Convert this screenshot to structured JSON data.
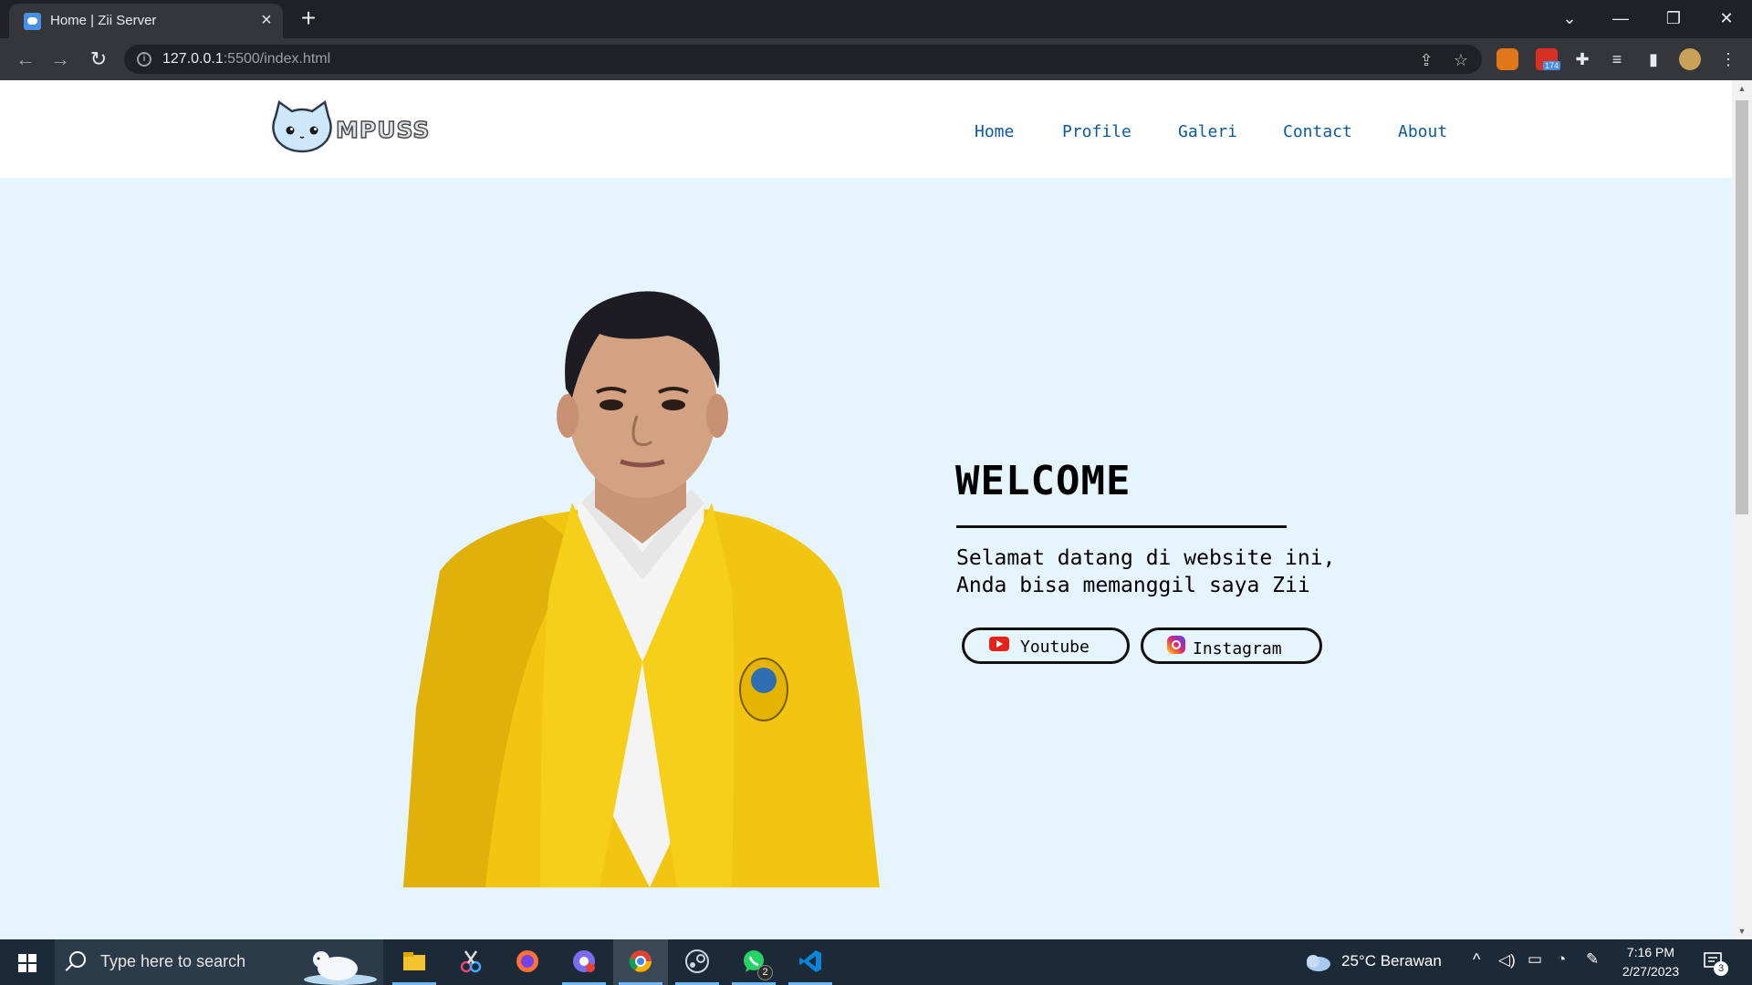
{
  "browser": {
    "tab_title": "Home | Zii Server",
    "url_host": "127.0.0.1",
    "url_rest": ":5500/index.html",
    "extension_badge": "174"
  },
  "site": {
    "logo_text": "MPUSS",
    "nav": [
      "Home",
      "Profile",
      "Galeri",
      "Contact",
      "About"
    ],
    "hero": {
      "heading": "WELCOME",
      "text": "Selamat datang di website ini,\nAnda bisa memanggil saya Zii",
      "buttons": {
        "youtube": "Youtube",
        "instagram": "Instagram"
      }
    }
  },
  "taskbar": {
    "search_placeholder": "Type here to search",
    "whatsapp_badge": "2",
    "weather": "25°C  Berawan",
    "time": "7:16 PM",
    "date": "2/27/2023",
    "notification_count": "3"
  },
  "colors": {
    "page_bg": "#e6f4fd",
    "nav_link": "#0b5a9c",
    "jacket_yellow": "#f2c511",
    "taskbar": "#1c2a38"
  }
}
